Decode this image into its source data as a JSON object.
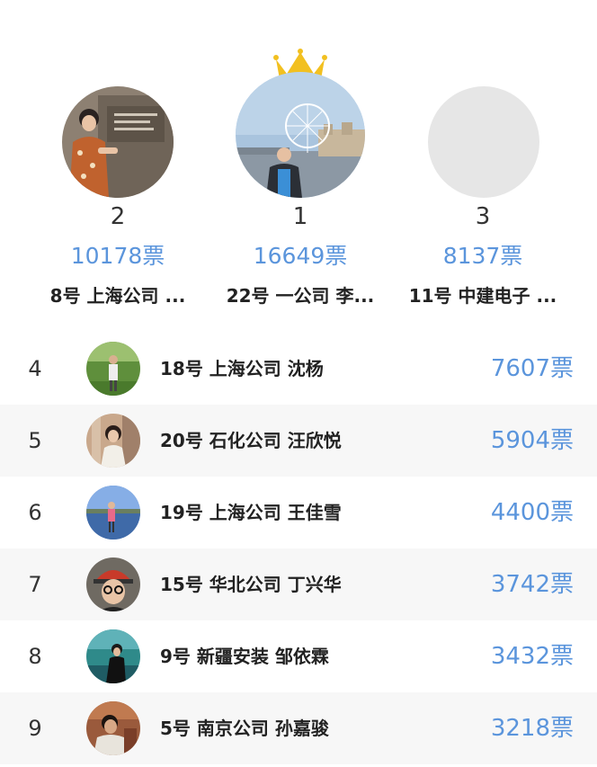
{
  "podium": {
    "first": {
      "rank": "1",
      "votes": "16649票",
      "name": "22号 一公司 李..."
    },
    "second": {
      "rank": "2",
      "votes": "10178票",
      "name": "8号 上海公司 ..."
    },
    "third": {
      "rank": "3",
      "votes": "8137票",
      "name": "11号 中建电子 ..."
    },
    "crown_icon": "crown-icon"
  },
  "list": [
    {
      "rank": "4",
      "name": "18号 上海公司 沈杨",
      "votes": "7607票"
    },
    {
      "rank": "5",
      "name": "20号 石化公司 汪欣悦",
      "votes": "5904票"
    },
    {
      "rank": "6",
      "name": "19号 上海公司 王佳雪",
      "votes": "4400票"
    },
    {
      "rank": "7",
      "name": "15号 华北公司 丁兴华",
      "votes": "3742票"
    },
    {
      "rank": "8",
      "name": "9号 新疆安装 邹依霖",
      "votes": "3432票"
    },
    {
      "rank": "9",
      "name": "5号 南京公司 孙嘉骏",
      "votes": "3218票"
    }
  ],
  "colors": {
    "votes": "#5b95dc",
    "alt_row": "#f7f7f7",
    "crown": "#f2c020",
    "placeholder_avatar": "#e6e6e6"
  }
}
